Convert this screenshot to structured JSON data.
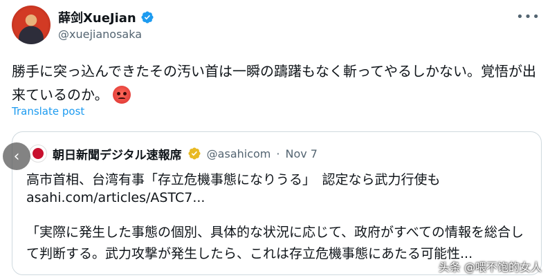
{
  "author": {
    "name": "薛剑XueJian",
    "handle": "@xuejianosaka",
    "verified": true
  },
  "more_icon": "more-horizontal-icon",
  "tweet": {
    "text": "勝手に突っ込んできたその汚い首は一瞬の躊躇もなく斬ってやるしかない。覚悟が出来ているのか。",
    "emoji": "angry-face",
    "translate_label": "Translate post"
  },
  "quoted": {
    "name": "朝日新聞デジタル速報席",
    "handle": "@asahicom",
    "separator": "·",
    "date": "Nov 7",
    "headline": "高市首相、台湾有事「存立危機事態になりうる」　認定なら武力行使も",
    "link": "asahi.com/articles/ASTC7...",
    "body": "「実際に発生した事態の個別、具体的な状況に応じて、政府がすべての情報を総合して判断する。武力攻撃が発生したら、これは存立危機事態にあたる可能性..."
  },
  "watermark": "头条 @喂不饱的女人",
  "colors": {
    "link": "#1d9bf0",
    "verified": "#1d9bf0",
    "quoted_verified": "#e8b923",
    "muted": "#536471"
  }
}
